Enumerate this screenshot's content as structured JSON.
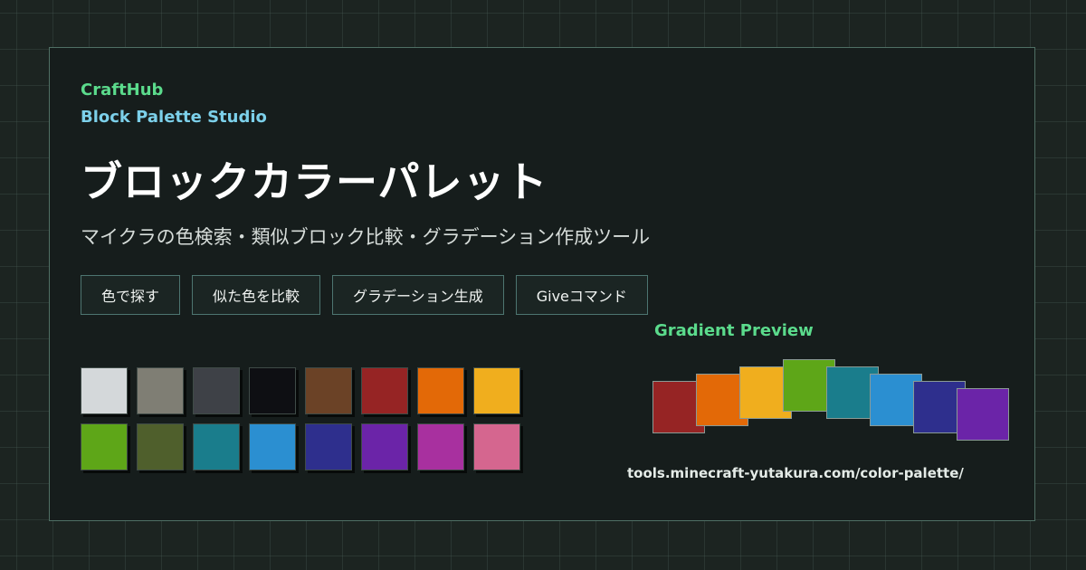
{
  "brand": {
    "name": "CraftHub",
    "product": "Block Palette Studio"
  },
  "hero": {
    "title": "ブロックカラーパレット",
    "subtitle": "マイクラの色検索・類似ブロック比較・グラデーション作成ツール"
  },
  "buttons": [
    {
      "label": "色で探す"
    },
    {
      "label": "似た色を比較"
    },
    {
      "label": "グラデーション生成"
    },
    {
      "label": "Giveコマンド"
    }
  ],
  "swatches": [
    "#d4d8da",
    "#7f7e74",
    "#3e4147",
    "#0e0f13",
    "#6b4226",
    "#962424",
    "#e36907",
    "#f0ae1e",
    "#5ea618",
    "#4f5f2c",
    "#1a7d8c",
    "#2b8fd1",
    "#2e2f8d",
    "#6b24a8",
    "#a8309f",
    "#d5668f"
  ],
  "gradient_preview": {
    "label": "Gradient Preview",
    "colors": [
      "#962424",
      "#e36907",
      "#f0ae1e",
      "#5ea618",
      "#1a7d8c",
      "#2b8fd1",
      "#2e2f8d",
      "#6b24a8"
    ]
  },
  "footer": {
    "url": "tools.minecraft-yutakura.com/color-palette/"
  }
}
